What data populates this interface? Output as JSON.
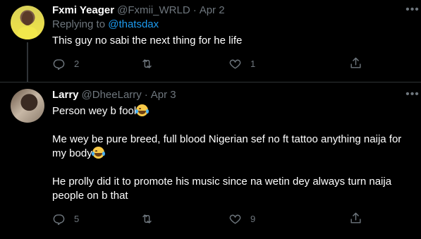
{
  "colors": {
    "background": "#000000",
    "text": "#ffffff",
    "muted": "#6e767d",
    "link": "#1d9bf0",
    "divider": "#2f3336"
  },
  "tweets": [
    {
      "name": "Fxmi Yeager",
      "handle": "@Fxmii_WRLD",
      "separator": "·",
      "date": "Apr 2",
      "reply_prefix": "Replying to ",
      "reply_mention": "@thatsdax",
      "text": "This guy no sabi the next thing for he life",
      "replies": "2",
      "retweets": "",
      "likes": "1",
      "avatar_icon": "user-avatar-icon"
    },
    {
      "name": "Larry",
      "handle": "@DheeLarry",
      "separator": "·",
      "date": "Apr 3",
      "paragraphs": [
        "Person wey b fool",
        "Me wey be pure breed, full blood Nigerian sef no ft tattoo anything naija for my body",
        "He prolly did it to promote his music since na wetin dey always turn naija people on b that"
      ],
      "replies": "5",
      "retweets": "",
      "likes": "9",
      "avatar_icon": "user-avatar-icon"
    }
  ],
  "icons": {
    "reply": "reply-icon",
    "retweet": "retweet-icon",
    "like": "heart-icon",
    "share": "share-icon",
    "more": "more-icon",
    "emoji": "face-with-tears-of-joy-emoji"
  }
}
